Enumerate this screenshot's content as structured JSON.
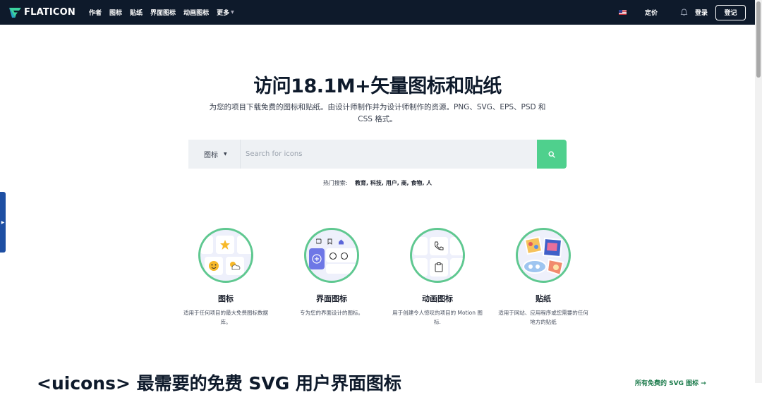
{
  "nav": {
    "brand": "FLATICON",
    "links": [
      "作者",
      "图标",
      "贴纸",
      "界面图标",
      "动画图标",
      "更多"
    ],
    "pricing": "定价",
    "login": "登录",
    "signup": "登记"
  },
  "hero": {
    "title": "访问18.1M+矢量图标和贴纸",
    "subtitle": "为您的项目下载免费的图标和贴纸。由设计师制作并为设计师制作的资源。PNG、SVG、EPS、PSD 和 CSS 格式。"
  },
  "search": {
    "type": "图标",
    "placeholder": "Search for icons"
  },
  "popular": {
    "label": "热门搜索:",
    "terms": "教育, 科技, 用户, 商, 食物, 人"
  },
  "categories": [
    {
      "title": "图标",
      "desc": "适用于任何项目的最大免费图标数据库。"
    },
    {
      "title": "界面图标",
      "desc": "专为您的界面设计的图标。"
    },
    {
      "title": "动画图标",
      "desc": "用于创建令人惊叹的项目的 Motion 图标."
    },
    {
      "title": "贴纸",
      "desc": "适用于网站、应用程序或您需要的任何地方的贴纸"
    }
  ],
  "section": {
    "heading": "<uicons> 最需要的免费 SVG 用户界面图标",
    "link": "所有免费的 SVG 图标 →"
  },
  "colors": {
    "nav_bg": "#0e1a2b",
    "accent": "#4fd08d",
    "side_tab": "#1e4fa3"
  }
}
